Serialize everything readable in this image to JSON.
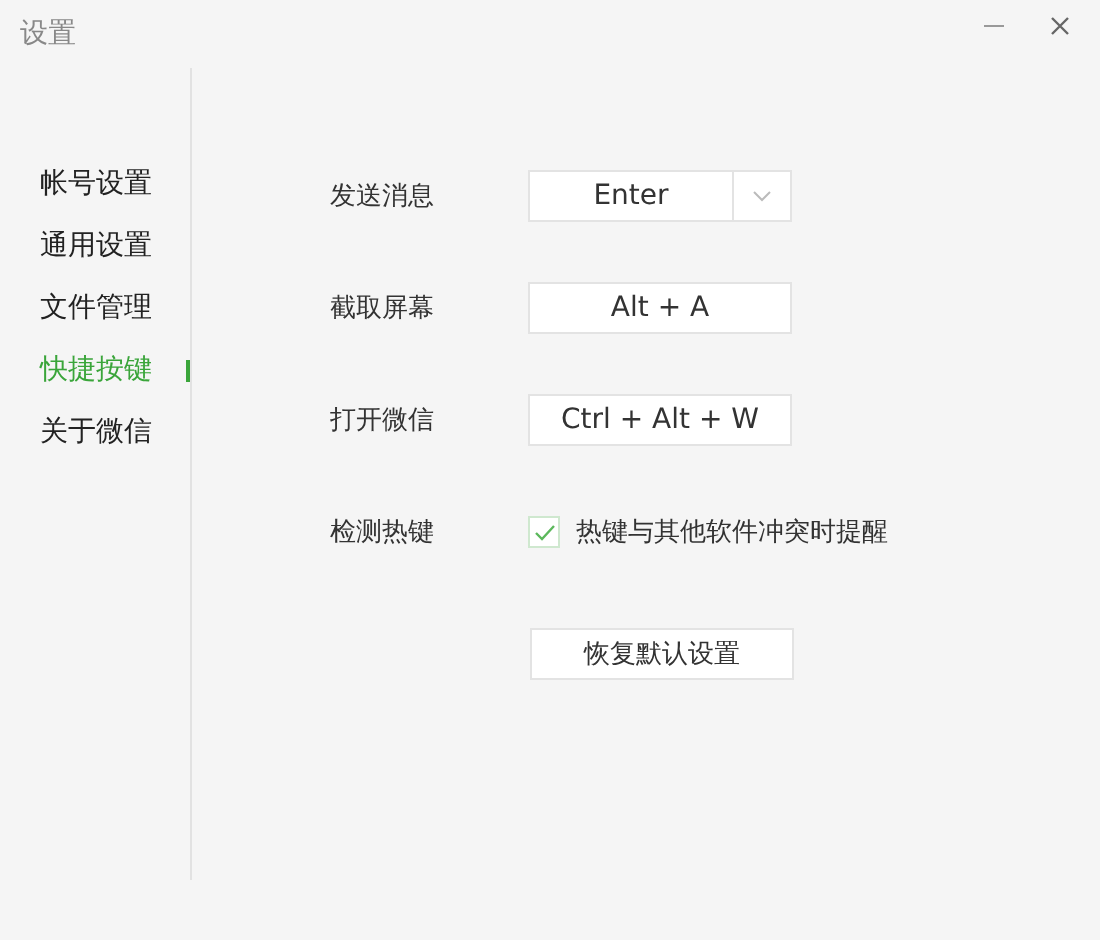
{
  "window": {
    "title": "设置"
  },
  "sidebar": {
    "items": [
      {
        "label": "帐号设置",
        "selected": false
      },
      {
        "label": "通用设置",
        "selected": false
      },
      {
        "label": "文件管理",
        "selected": false
      },
      {
        "label": "快捷按键",
        "selected": true
      },
      {
        "label": "关于微信",
        "selected": false
      }
    ]
  },
  "settings": [
    {
      "kind": "dropdown",
      "label": "发送消息",
      "value": "Enter"
    },
    {
      "kind": "key",
      "label": "截取屏幕",
      "value": "Alt + A"
    },
    {
      "kind": "key",
      "label": "打开微信",
      "value": "Ctrl + Alt + W"
    },
    {
      "kind": "checkbox",
      "label": "检测热键",
      "text": "热键与其他软件冲突时提醒",
      "checked": true
    }
  ],
  "reset_button": "恢复默认设置"
}
